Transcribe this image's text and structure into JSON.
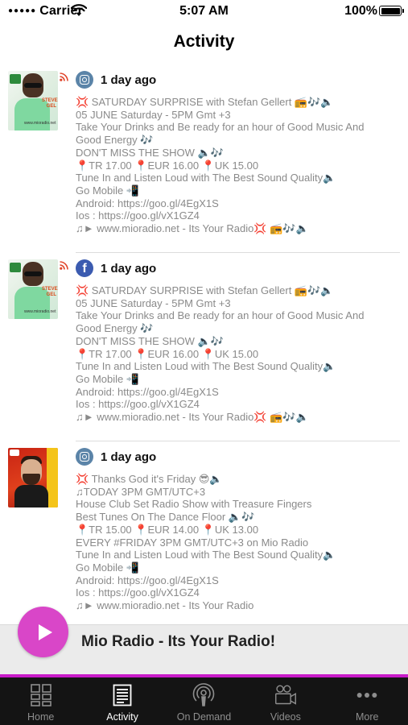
{
  "status_bar": {
    "carrier": "Carrier",
    "time": "5:07 AM",
    "battery": "100%"
  },
  "header": {
    "title": "Activity"
  },
  "posts": [
    {
      "source": "instagram",
      "time_ago": "1 day ago",
      "text": "💢 SATURDAY SURPRISE with Stefan Gellert 📻🎶🔈\n05 JUNE Saturday - 5PM Gmt +3\nTake Your Drinks and Be ready for an hour of Good Music And Good Energy 🎶\nDON'T MISS THE SHOW 🔈🎶\n📍TR 17.00 📍EUR 16.00 📍UK 15.00\nTune In and Listen Loud with The Best Sound Quality🔈\nGo Mobile 📲\nAndroid: https://goo.gl/4EgX1S\nIos : https://goo.gl/vX1GZ4\n♫► www.mioradio.net - Its Your Radio💢 📻🎶🔈"
    },
    {
      "source": "facebook",
      "time_ago": "1 day ago",
      "text": "💢 SATURDAY SURPRISE with Stefan Gellert 📻🎶🔈\n05 JUNE Saturday - 5PM Gmt +3\nTake Your Drinks and Be ready for an hour of Good Music And Good Energy 🎶\nDON'T MISS THE SHOW 🔈🎶\n📍TR 17.00 📍EUR 16.00 📍UK 15.00\nTune In and Listen Loud with The Best Sound Quality🔈\nGo Mobile 📲\nAndroid: https://goo.gl/4EgX1S\nIos : https://goo.gl/vX1GZ4\n♫► www.mioradio.net - Its Your Radio💢 📻🎶🔈"
    },
    {
      "source": "instagram",
      "time_ago": "1 day ago",
      "text": "💢 Thanks God it's Friday 😎🔈\n♫TODAY 3PM GMT/UTC+3\nHouse Club Set Radio Show with Treasure Fingers\nBest Tunes On The Dance Floor 🔈🎶\n📍TR 15.00 📍EUR 14.00 📍UK 13.00\nEVERY #FRIDAY 3PM GMT/UTC+3 on Mio Radio\nTune In and Listen Loud with The Best Sound Quality🔈\nGo Mobile 📲\nAndroid: https://goo.gl/4EgX1S\nIos : https://goo.gl/vX1GZ4\n♫► www.mioradio.net - Its Your Radio"
    }
  ],
  "player": {
    "title": "Mio Radio - Its Your Radio!",
    "accent_color": "#d946c8"
  },
  "tabs": [
    {
      "label": "Home",
      "icon": "home-grid-icon",
      "active": false
    },
    {
      "label": "Activity",
      "icon": "activity-list-icon",
      "active": true
    },
    {
      "label": "On Demand",
      "icon": "podcast-icon",
      "active": false
    },
    {
      "label": "Videos",
      "icon": "video-camera-icon",
      "active": false
    },
    {
      "label": "More",
      "icon": "more-dots-icon",
      "active": false
    }
  ]
}
